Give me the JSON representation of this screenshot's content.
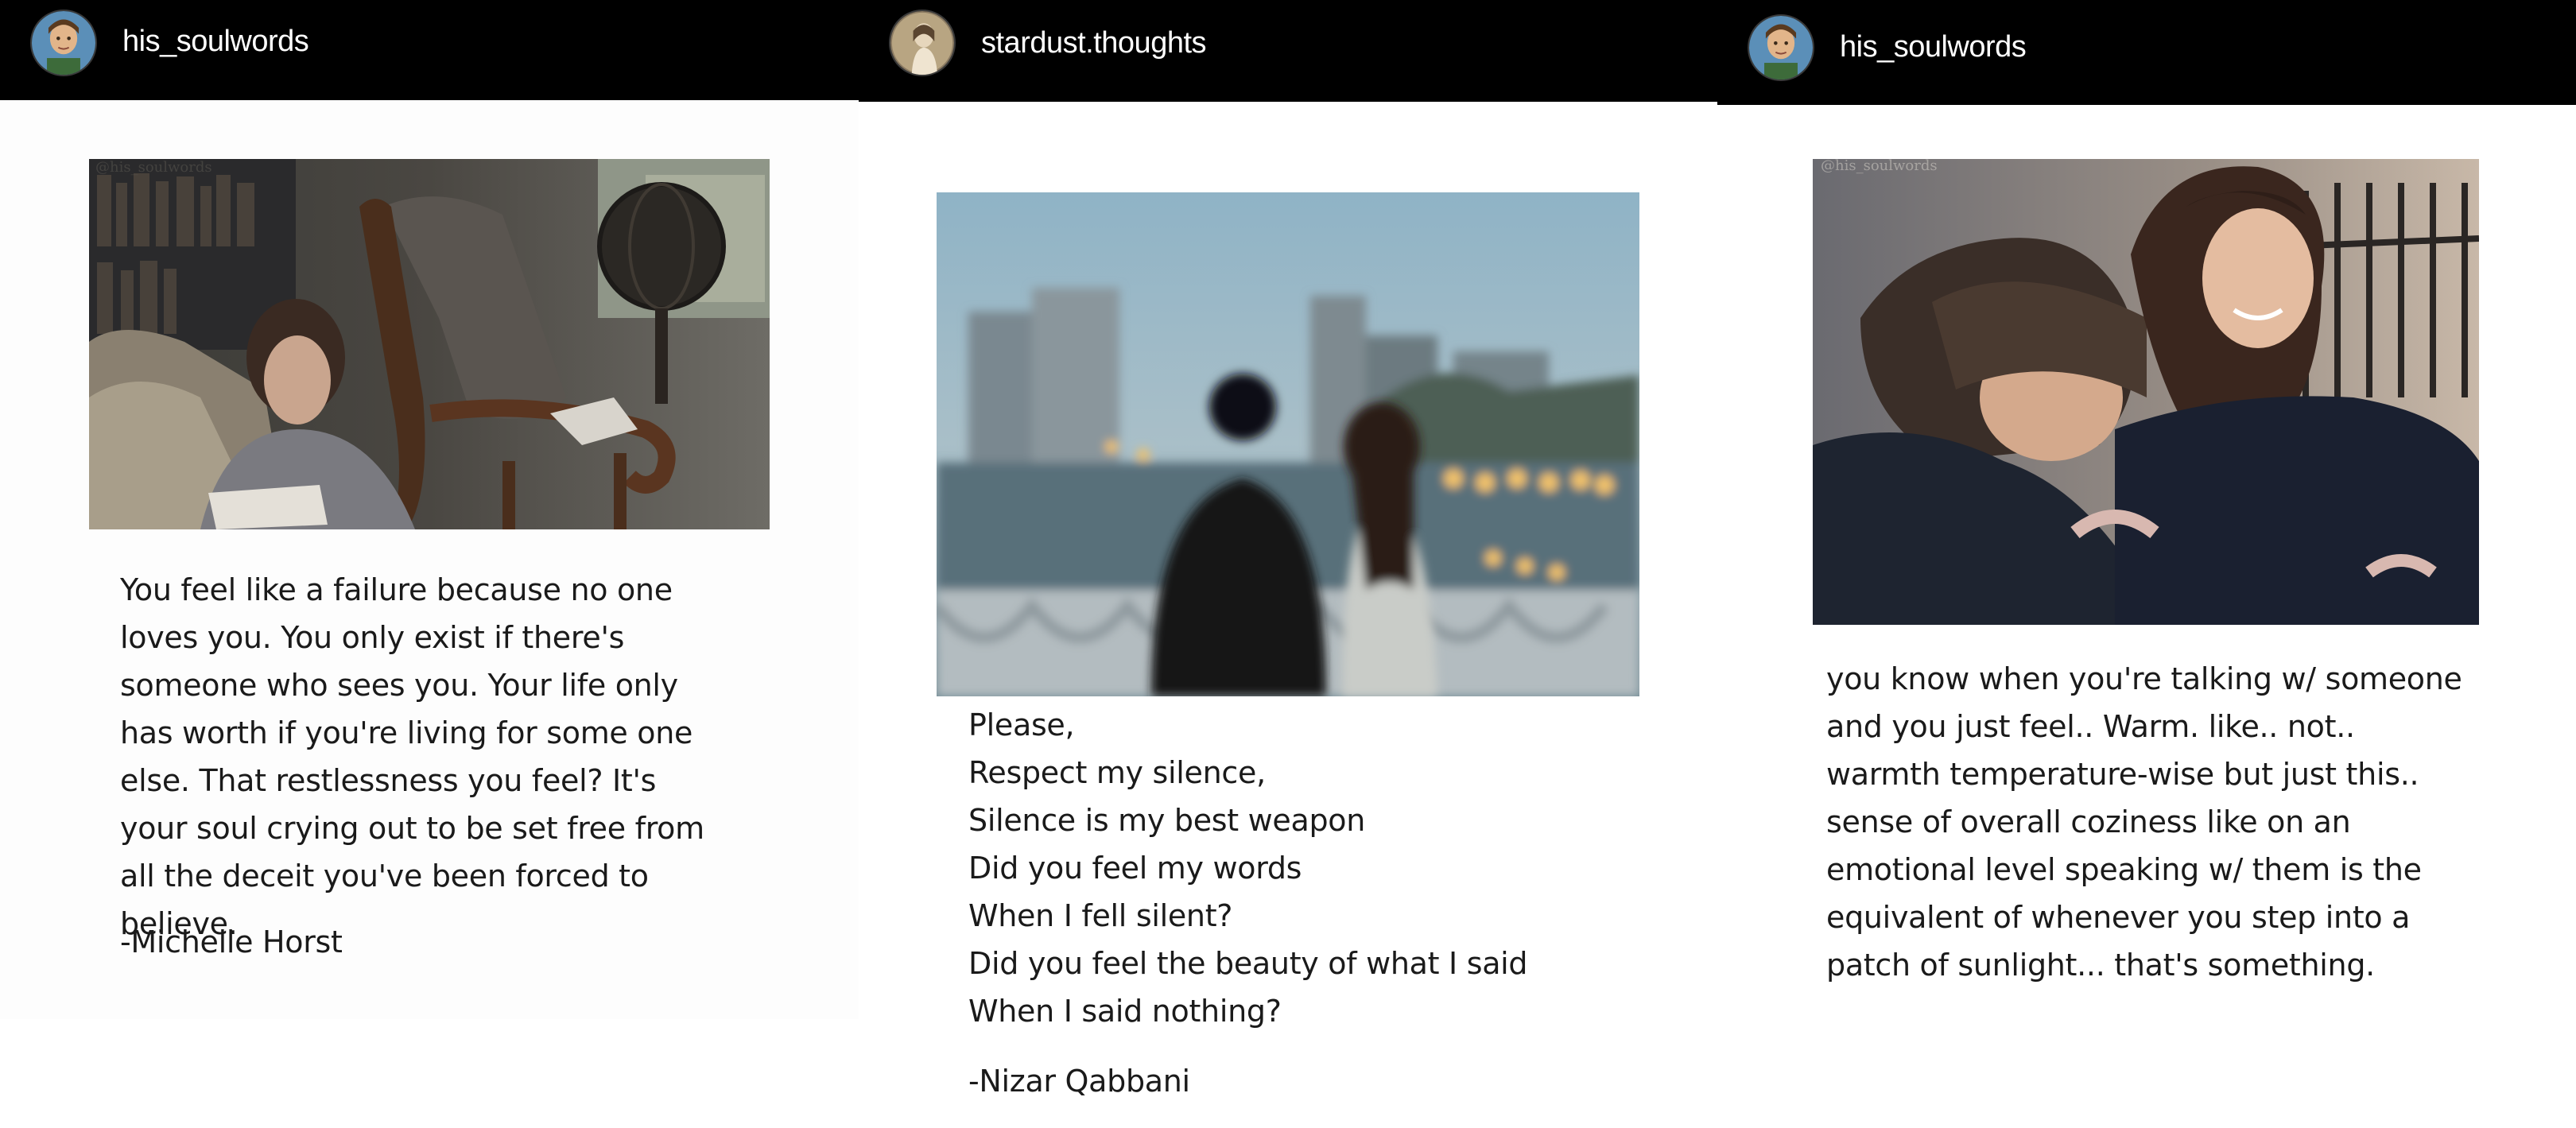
{
  "posts": [
    {
      "username": "his_soulwords",
      "avatar_icon": "avatar-icon",
      "quote": "You feel like a failure because no one loves you. You only exist if there's someone who sees you. Your life only has worth if you're living for some one else. That restlessness you feel? It's your soul crying out to be set free from all the deceit you've been forced to believe.",
      "author": "-Michelle Horst"
    },
    {
      "username": "stardust.thoughts",
      "avatar_icon": "avatar-icon",
      "poem_lines": [
        "Please,",
        "Respect my silence,",
        "Silence is my best weapon",
        "Did you feel my words",
        "When I fell silent?",
        "Did you feel the beauty of what I said",
        "When I said nothing?"
      ],
      "author": "-Nizar Qabbani"
    },
    {
      "username": "his_soulwords",
      "avatar_icon": "avatar-icon",
      "quote": "you know when you're talking w/ someone and you just feel.. Warm. like.. not.. warmth temperature-wise but just this.. sense of overall coziness like on an emotional level speaking w/ them is the equivalent of whenever you step into a patch of sunlight... that's something."
    }
  ],
  "colors": {
    "header_bg": "#000000",
    "header_text": "#ffffff",
    "body_text": "#1a1a1a"
  }
}
